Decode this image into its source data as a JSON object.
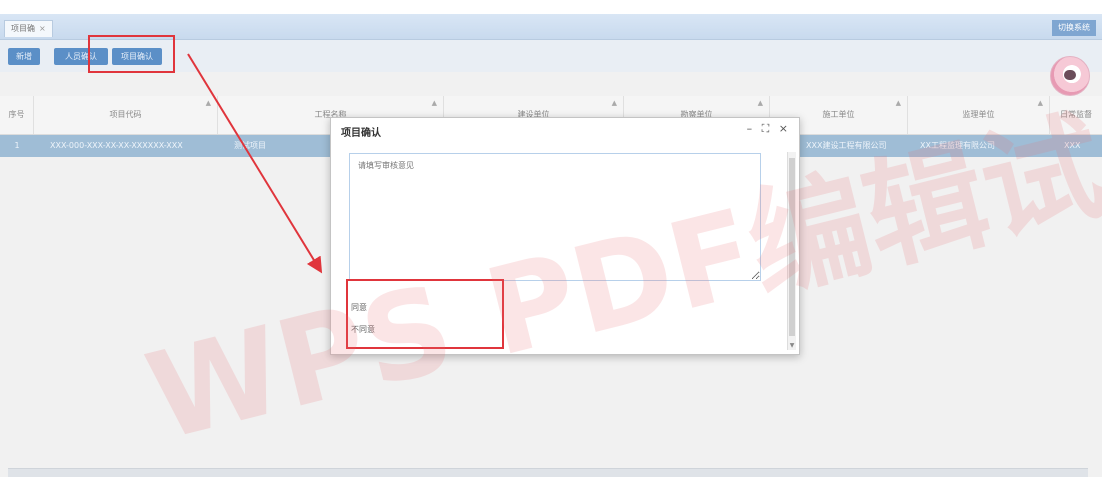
{
  "tabbar": {
    "tab_label": "项目确",
    "tab_close": "×",
    "right_button": "切换系统"
  },
  "toolbar": {
    "buttons": [
      "新增",
      "人员确认",
      "项目确认"
    ]
  },
  "grid": {
    "columns": [
      "序号",
      "项目代码",
      "工程名称",
      "建设单位",
      "勘察单位",
      "施工单位",
      "监理单位",
      "日常监督"
    ],
    "rows": [
      [
        "1",
        "XXX-000-XXX-XX-XX-XXXXXX-XXX",
        "测试项目",
        "",
        "",
        "XXX建设工程有限公司",
        "XX工程监理有限公司",
        "XXX"
      ]
    ]
  },
  "dialog": {
    "title": "项目确认",
    "controls": "– ⛶ ×",
    "textarea_placeholder": "请填写审核意见",
    "options": [
      "同意",
      "不同意"
    ]
  },
  "watermark": {
    "text": "WPS PDF编辑试用"
  },
  "colors": {
    "highlight": "#e0353c",
    "row_selected": "#9fbdd6",
    "button": "#5b8fc7"
  }
}
